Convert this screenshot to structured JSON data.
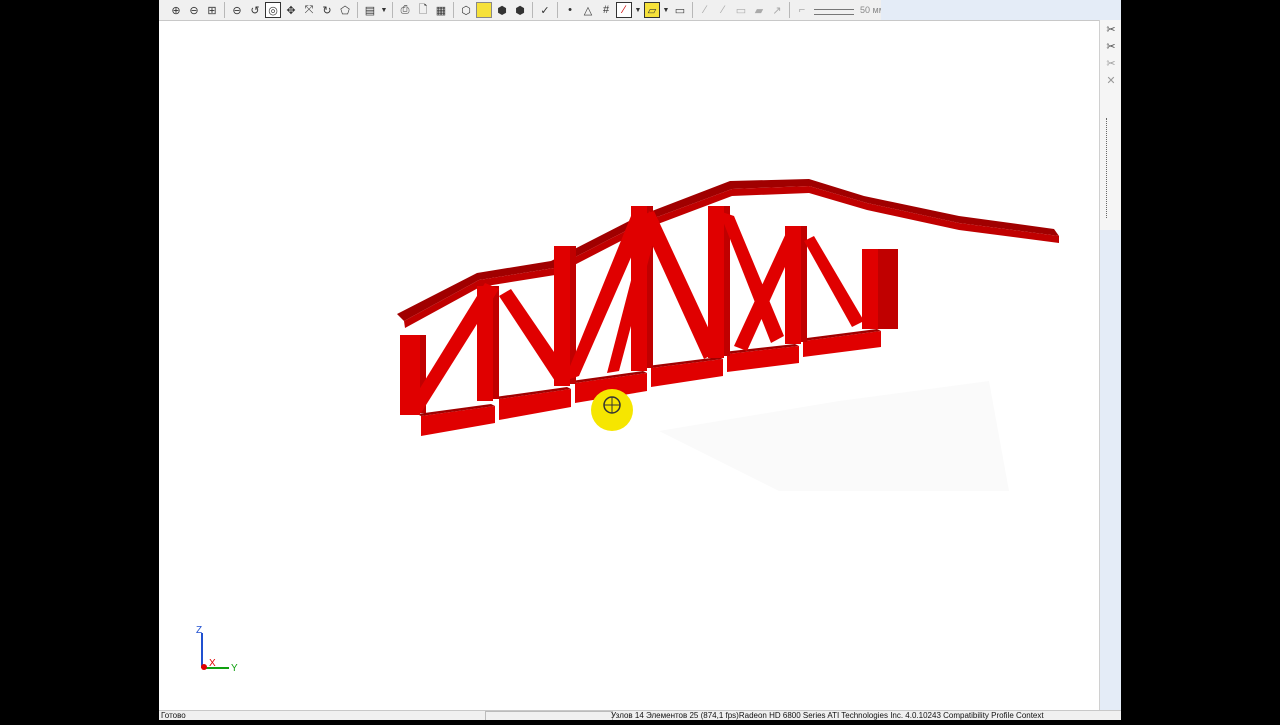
{
  "toolbar": {
    "units_label": "50 мм",
    "groups": [
      [
        "zoom-in-icon",
        "zoom-out-icon",
        "zoom-window-icon"
      ],
      [
        "zoom-previous-icon",
        "zoom-dynamic-icon",
        "zoom-selected-icon",
        "pan-icon",
        "rotate-icon",
        "rotate-axis-icon",
        "perspective-icon"
      ],
      [
        "view-menu-icon"
      ],
      [
        "print-icon",
        "print-preview-icon",
        "report-icon"
      ],
      [
        "wireframe-icon",
        "shaded-icon",
        "solid-icon",
        "solid-dark-icon"
      ],
      [
        "numbering-icon"
      ],
      [
        "node-icon",
        "supports-icon",
        "grid-icon",
        "pen-icon",
        "eraser-icon",
        "layer-icon"
      ],
      [
        "tool-1-icon",
        "tool-2-icon",
        "tool-3-icon",
        "tool-4-icon",
        "tool-5-icon"
      ]
    ]
  },
  "axes": {
    "z": "Z",
    "x": "X",
    "y": "Y"
  },
  "status": {
    "ready": "Готово",
    "info": "Узлов 14  Элементов 25  (874,1 fps)Radeon HD 6800 Series ATI Technologies Inc. 4.0.10243 Compatibility Profile Context"
  },
  "colors": {
    "truss_front": "#e00000",
    "truss_top": "#a00000",
    "truss_side": "#c00000",
    "cursor_highlight": "#f6e600"
  }
}
